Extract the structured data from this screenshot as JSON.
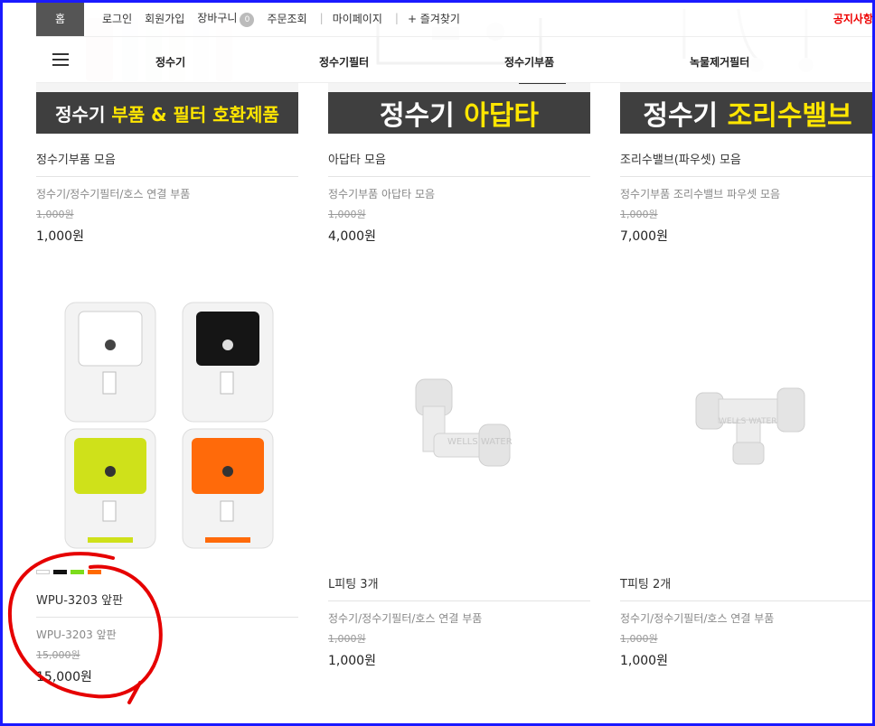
{
  "topbar": {
    "home": "홈",
    "links": [
      "로그인",
      "회원가입",
      "장바구니",
      "주문조회",
      "마이페이지",
      "+ 즐겨찾기"
    ],
    "cart_count": "0",
    "notice": "공지사항"
  },
  "nav": {
    "items": [
      "정수기",
      "정수기필터",
      "정수기부품",
      "녹물제거필터"
    ],
    "active": "정수기부품"
  },
  "banners": [
    {
      "normal": "정수기 ",
      "highlight": "부품 & 필터 호환제품"
    },
    {
      "normal": "정수기 ",
      "highlight": "아답타"
    },
    {
      "normal": "정수기 ",
      "highlight": "조리수밸브"
    }
  ],
  "products": [
    {
      "name": "정수기부품 모음",
      "desc": "정수기/정수기필터/호스 연결 부품",
      "old_price": "1,000원",
      "price": "1,000원"
    },
    {
      "name": "아답타 모음",
      "desc": "정수기부품 아답타 모음",
      "old_price": "1,000원",
      "price": "4,000원"
    },
    {
      "name": "조리수밸브(파우셋) 모음",
      "desc": "정수기부품 조리수밸브 파우셋 모음",
      "old_price": "1,000원",
      "price": "7,000원"
    },
    {
      "name": "WPU-3203 앞판",
      "desc": "WPU-3203 앞판",
      "old_price": "15,000원",
      "price": "15,000원"
    },
    {
      "name": "L피팅 3개",
      "desc": "정수기/정수기필터/호스 연결 부품",
      "old_price": "1,000원",
      "price": "1,000원"
    },
    {
      "name": "T피팅 2개",
      "desc": "정수기/정수기필터/호스 연결 부품",
      "old_price": "1,000원",
      "price": "1,000원"
    }
  ],
  "watermark": "WELLS WATER",
  "swatch_colors": [
    "#ffffff",
    "#111111",
    "#7cdc1c",
    "#ff6a00"
  ],
  "colors": {
    "accent": "#1a1aff",
    "annotation": "#e60000",
    "banner_bg": "#3f3f3f",
    "banner_highlight": "#ffe600"
  }
}
